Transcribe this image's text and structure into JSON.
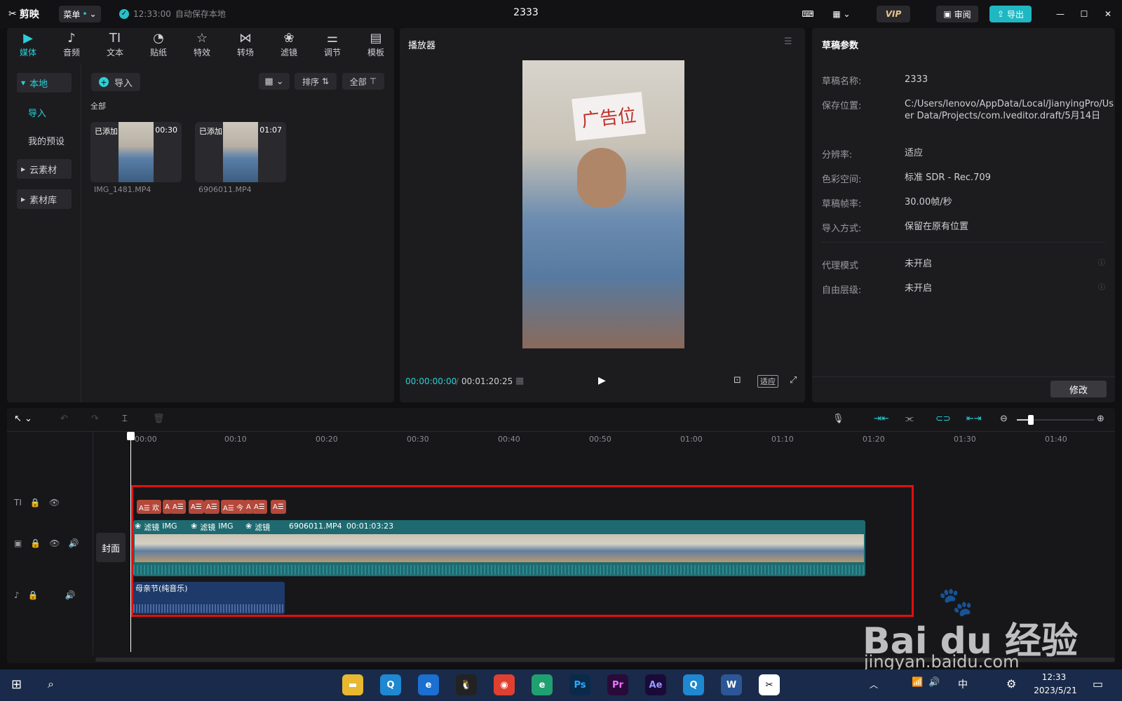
{
  "app": {
    "name": "剪映",
    "menu_label": "菜单",
    "save_time": "12:33:00",
    "save_text": "自动保存本地",
    "project_title": "2333",
    "review_label": "审阅",
    "export_label": "导出",
    "vip_label": "VIP"
  },
  "toolbar": [
    {
      "label": "媒体",
      "icon": "media-icon"
    },
    {
      "label": "音频",
      "icon": "audio-icon"
    },
    {
      "label": "文本",
      "icon": "text-icon"
    },
    {
      "label": "贴纸",
      "icon": "sticker-icon"
    },
    {
      "label": "特效",
      "icon": "effect-icon"
    },
    {
      "label": "转场",
      "icon": "transition-icon"
    },
    {
      "label": "滤镜",
      "icon": "filter-icon"
    },
    {
      "label": "调节",
      "icon": "adjust-icon"
    },
    {
      "label": "模板",
      "icon": "template-icon"
    }
  ],
  "sidebar": {
    "local": "本地",
    "import": "导入",
    "presets": "我的预设",
    "cloud": "云素材",
    "library": "素材库"
  },
  "media": {
    "import_button": "导入",
    "sort_label": "排序",
    "filter_label": "全部",
    "section_label": "全部",
    "items": [
      {
        "name": "IMG_1481.MP4",
        "status": "已添加",
        "duration": "00:30"
      },
      {
        "name": "6906011.MP4",
        "status": "已添加",
        "duration": "01:07"
      }
    ]
  },
  "player": {
    "title": "播放器",
    "current_time": "00:00:00:00",
    "total_time": "00:01:20:25",
    "fit_label": "适应",
    "sign_text": "广告位"
  },
  "draft": {
    "title": "草稿参数",
    "modify_button": "修改",
    "rows": [
      {
        "label": "草稿名称:",
        "value": "2333"
      },
      {
        "label": "保存位置:",
        "value": "C:/Users/lenovo/AppData/Local/JianyingPro/User Data/Projects/com.lveditor.draft/5月14日"
      },
      {
        "label": "分辨率:",
        "value": "适应"
      },
      {
        "label": "色彩空间:",
        "value": "标准 SDR - Rec.709"
      },
      {
        "label": "草稿帧率:",
        "value": "30.00帧/秒"
      },
      {
        "label": "导入方式:",
        "value": "保留在原有位置"
      },
      {
        "label": "代理模式",
        "value": "未开启"
      },
      {
        "label": "自由层级:",
        "value": "未开启"
      }
    ]
  },
  "timeline": {
    "ruler": [
      "00:00",
      "00:10",
      "00:20",
      "00:30",
      "00:40",
      "00:50",
      "01:00",
      "01:10",
      "01:20",
      "01:30",
      "01:40"
    ],
    "cover_label": "封面",
    "clip_filter_label": "滤镜",
    "clip_img_label": "IMG",
    "main_clip_name": "6906011.MP4",
    "main_clip_duration": "00:01:03:23",
    "audio_clip_name": "母亲节(纯音乐)",
    "text_tags": [
      "A☰ 欢",
      "A",
      "A☰",
      "A☰",
      "A☰",
      "A☰ 今",
      "A",
      "A☰",
      "A☰"
    ]
  },
  "taskbar": {
    "time": "12:33",
    "date": "2023/5/21",
    "ime": "中"
  },
  "watermark": {
    "brand": "Bai du 经验",
    "url": "jingyan.baidu.com"
  },
  "colors": {
    "accent": "#2ad0d8",
    "text_clip": "#b4483a",
    "video_clip": "#1e6a70",
    "audio_clip": "#1e3a6a",
    "highlight": "#e01010"
  }
}
